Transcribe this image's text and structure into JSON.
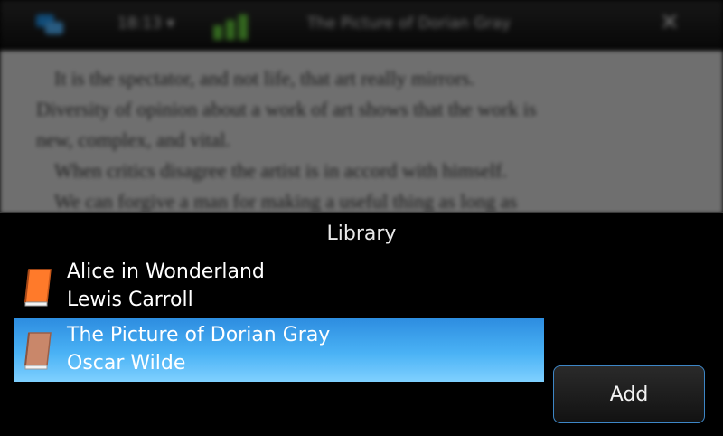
{
  "status_bar": {
    "time": "18:13 ▾",
    "title": "The Picture of Dorian Gray",
    "close_glyph": "✕",
    "icons": [
      "task-switcher-icon",
      "battery-icon",
      "close-icon"
    ]
  },
  "reader": {
    "paragraphs": [
      "It is the spectator, and not life, that art really mirrors.",
      "Diversity of opinion about a work of art shows that the work is",
      "new, complex, and vital.",
      "When critics disagree the artist is in accord with himself.",
      "We can forgive a man for making a useful thing as long as"
    ]
  },
  "dialog": {
    "title": "Library",
    "books": [
      {
        "title": "Alice in Wonderland",
        "author": "Lewis Carroll",
        "icon": "book-icon",
        "color": "#ff7a2a",
        "selected": false
      },
      {
        "title": "The Picture of Dorian Gray",
        "author": "Oscar Wilde",
        "icon": "book-icon",
        "color": "#c9876a",
        "selected": true
      }
    ],
    "add_label": "Add",
    "accent": "#2d8de0"
  }
}
